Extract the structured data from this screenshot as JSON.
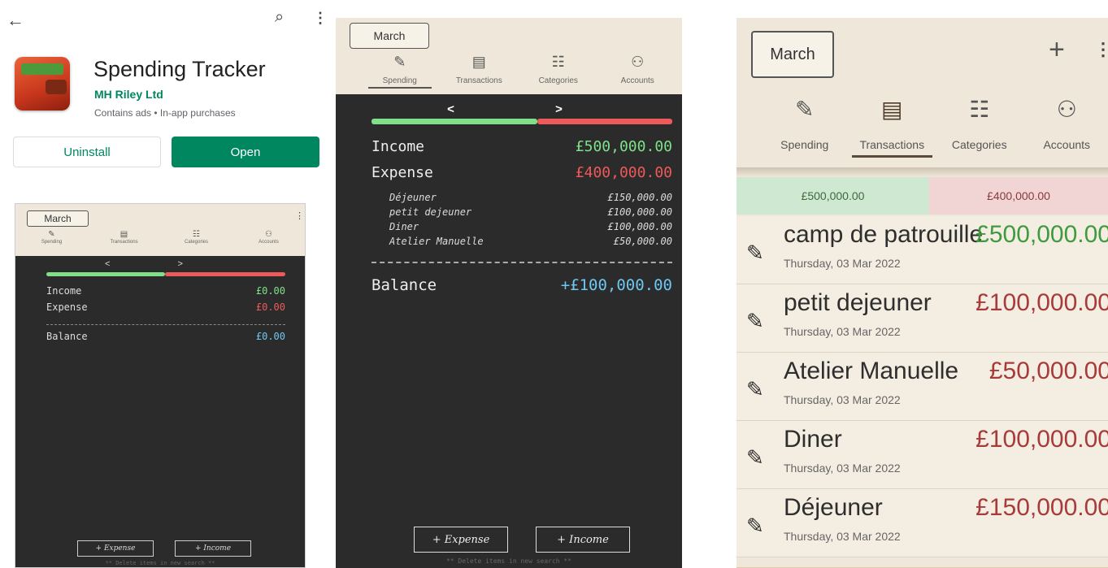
{
  "store": {
    "back_icon": "←",
    "search_icon": "⌕",
    "more_icon": "⋮",
    "app_title": "Spending Tracker",
    "developer": "MH Riley Ltd",
    "meta": "Contains ads  •  In-app purchases",
    "uninstall_label": "Uninstall",
    "open_label": "Open",
    "accent": "#01875f"
  },
  "mini": {
    "month": "March",
    "tabs": [
      "Spending",
      "Transactions",
      "Categories",
      "Accounts"
    ],
    "arrows": "< >",
    "income_label": "Income",
    "income_value": "£0.00",
    "expense_label": "Expense",
    "expense_value": "£0.00",
    "balance_label": "Balance",
    "balance_value": "£0.00",
    "expense_btn": "+ Expense",
    "income_btn": "+ Income",
    "footer": "** Delete items in new search **"
  },
  "spending": {
    "month": "March",
    "tabs": [
      "Spending",
      "Transactions",
      "Categories",
      "Accounts"
    ],
    "arrows": "< >",
    "income_label": "Income",
    "income_value": "£500,000.00",
    "expense_label": "Expense",
    "expense_value": "£400,000.00",
    "items": [
      {
        "label": "Déjeuner",
        "value": "£150,000.00"
      },
      {
        "label": "petit dejeuner",
        "value": "£100,000.00"
      },
      {
        "label": "Diner",
        "value": "£100,000.00"
      },
      {
        "label": "Atelier Manuelle",
        "value": "£50,000.00"
      }
    ],
    "balance_label": "Balance",
    "balance_value": "+£100,000.00",
    "expense_btn": "+ Expense",
    "income_btn": "+ Income",
    "footer": "** Delete items in new search **",
    "colors": {
      "income": "#7fe08a",
      "expense": "#ee5a5a",
      "balance": "#6ec8f2"
    }
  },
  "transactions": {
    "month": "March",
    "plus_icon": "+",
    "more_icon": "⋮",
    "tabs": [
      "Spending",
      "Transactions",
      "Categories",
      "Accounts"
    ],
    "income_total": "£500,000.00",
    "expense_total": "£400,000.00",
    "rows": [
      {
        "name": "camp de patrouille",
        "date": "Thursday, 03 Mar 2022",
        "amount": "£500,000.00",
        "type": "income"
      },
      {
        "name": "petit dejeuner",
        "date": "Thursday, 03 Mar 2022",
        "amount": "£100,000.00",
        "type": "expense"
      },
      {
        "name": "Atelier Manuelle",
        "date": "Thursday, 03 Mar 2022",
        "amount": "£50,000.00",
        "type": "expense"
      },
      {
        "name": "Diner",
        "date": "Thursday, 03 Mar 2022",
        "amount": "£100,000.00",
        "type": "expense"
      },
      {
        "name": "Déjeuner",
        "date": "Thursday, 03 Mar 2022",
        "amount": "£150,000.00",
        "type": "expense"
      }
    ],
    "colors": {
      "income": "#3f9a3f",
      "expense": "#a83a3a"
    }
  }
}
